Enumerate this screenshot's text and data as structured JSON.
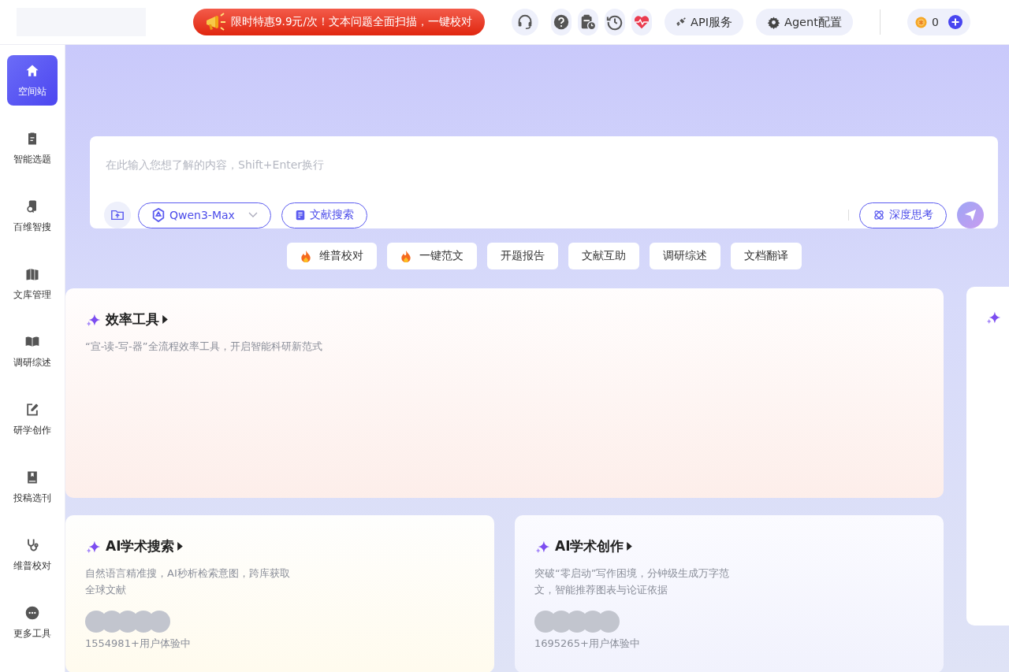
{
  "header": {
    "promo": "限时特惠9.9元/次！文本问题全面扫描，一键校对",
    "icon_buttons": [
      {
        "kind": "headset"
      },
      {
        "kind": "help"
      },
      {
        "kind": "schedule"
      },
      {
        "kind": "history"
      },
      {
        "kind": "health"
      }
    ],
    "api_button": "API服务",
    "agent_button": "Agent配置",
    "coins": "0"
  },
  "sidebar": {
    "items": [
      {
        "label": "空间站",
        "kind": "home",
        "selected": true
      },
      {
        "label": "智能选题",
        "kind": "clipboard",
        "selected": false
      },
      {
        "label": "百维智搜",
        "kind": "search-doc",
        "selected": false
      },
      {
        "label": "文库管理",
        "kind": "books",
        "selected": false
      },
      {
        "label": "调研综述",
        "kind": "book-open",
        "selected": false
      },
      {
        "label": "研学创作",
        "kind": "edit",
        "selected": false
      },
      {
        "label": "投稿选刊",
        "kind": "journal",
        "selected": false
      },
      {
        "label": "维普校对",
        "kind": "stethoscope",
        "selected": false
      },
      {
        "label": "更多工具",
        "kind": "more",
        "selected": false
      }
    ]
  },
  "search": {
    "placeholder": "在此输入您想了解的内容，Shift+Enter换行",
    "model": "Qwen3-Max",
    "literature": "文献搜索",
    "deep_think": "深度思考"
  },
  "quick_actions": [
    {
      "label": "维普校对",
      "hot": true
    },
    {
      "label": "一键范文",
      "hot": true
    },
    {
      "label": "开题报告",
      "hot": false
    },
    {
      "label": "文献互助",
      "hot": false
    },
    {
      "label": "调研综述",
      "hot": false
    },
    {
      "label": "文档翻译",
      "hot": false
    }
  ],
  "efficiency_card": {
    "title": "效率工具",
    "desc": "“宣-读-写-器”全流程效率工具，开启智能科研新范式"
  },
  "feature_cards": [
    {
      "title": "AI学术搜索",
      "desc": "自然语言精准搜，AI秒析检索意图，跨库获取全球文献",
      "users": "1554981+用户体验中"
    },
    {
      "title": "AI学术创作",
      "desc": "突破“零启动”写作困境，分钟级生成万字范文，智能推荐图表与论证依据",
      "users": "1695265+用户体验中"
    }
  ]
}
